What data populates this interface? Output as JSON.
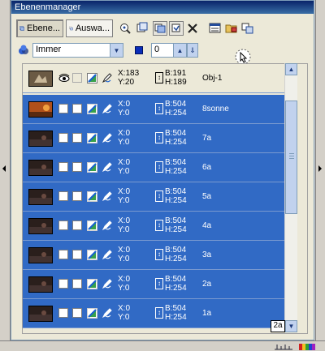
{
  "docker": {
    "title": "Ebenenmanager"
  },
  "toolbar": {
    "layers_button": "Ebene...",
    "selection_button": "Auswa...",
    "icons": [
      "layer-view-icon",
      "selection-view-icon",
      "zoom-settings-icon",
      "properties-icon",
      "shadow-icon",
      "delete-icon",
      "list-view-icon",
      "folder-icon",
      "group-icon"
    ]
  },
  "options": {
    "mode_value": "Immer",
    "number_value": "0"
  },
  "rows": [
    {
      "name": "Obj-1",
      "x": "X:183",
      "y": "Y:20",
      "w": "B:191",
      "h": "H:189",
      "selected": false
    },
    {
      "name": "8sonne",
      "x": "X:0",
      "y": "Y:0",
      "w": "B:504",
      "h": "H:254",
      "selected": true
    },
    {
      "name": "7a",
      "x": "X:0",
      "y": "Y:0",
      "w": "B:504",
      "h": "H:254",
      "selected": true
    },
    {
      "name": "6a",
      "x": "X:0",
      "y": "Y:0",
      "w": "B:504",
      "h": "H:254",
      "selected": true
    },
    {
      "name": "5a",
      "x": "X:0",
      "y": "Y:0",
      "w": "B:504",
      "h": "H:254",
      "selected": true
    },
    {
      "name": "4a",
      "x": "X:0",
      "y": "Y:0",
      "w": "B:504",
      "h": "H:254",
      "selected": true
    },
    {
      "name": "3a",
      "x": "X:0",
      "y": "Y:0",
      "w": "B:504",
      "h": "H:254",
      "selected": true
    },
    {
      "name": "2a",
      "x": "X:0",
      "y": "Y:0",
      "w": "B:504",
      "h": "H:254",
      "selected": true
    },
    {
      "name": "1a",
      "x": "X:0",
      "y": "Y:0",
      "w": "B:504",
      "h": "H:254",
      "selected": true
    }
  ],
  "tooltip": "2a",
  "colors": {
    "selection": "#316ac5",
    "title": "#0a246a"
  }
}
